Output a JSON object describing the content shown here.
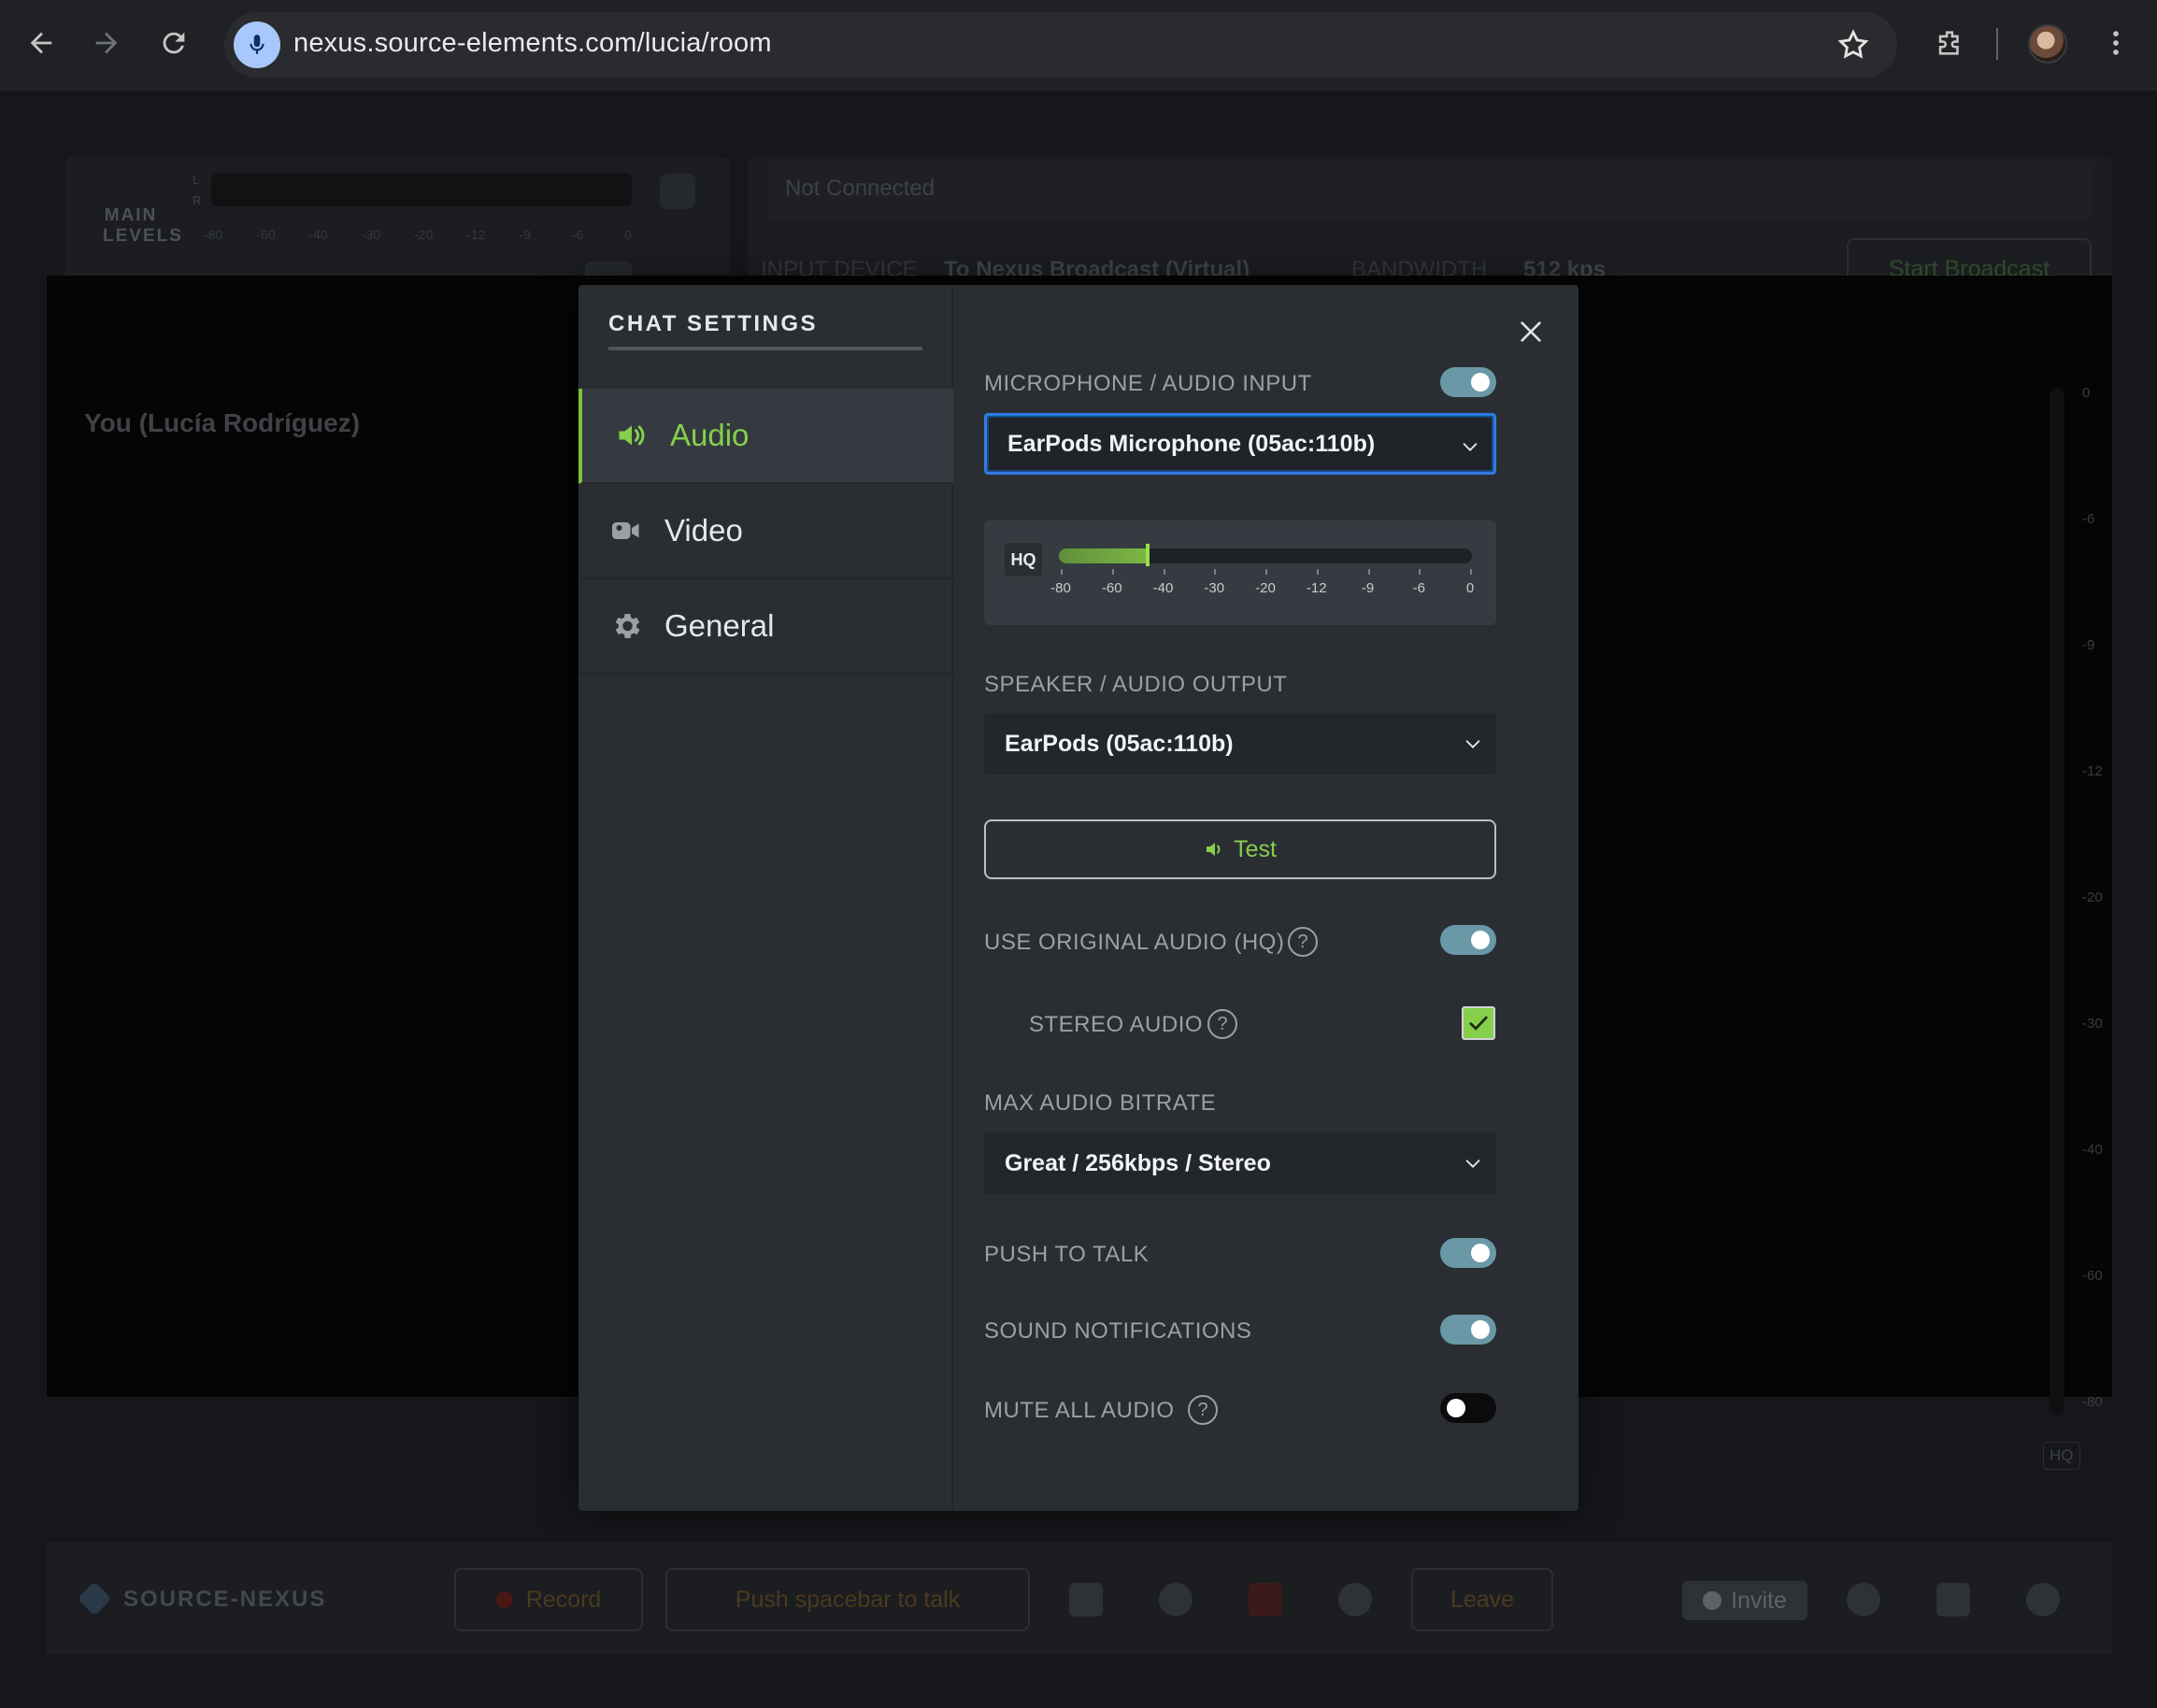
{
  "browser": {
    "url": "nexus.source-elements.com/lucia/room"
  },
  "app_bg": {
    "main_levels": "MAIN\nLEVELS",
    "main_levels_line1": "MAIN",
    "main_levels_line2": "LEVELS",
    "lr_l": "L",
    "lr_r": "R",
    "scale": [
      "-80",
      "-60",
      "-40",
      "-30",
      "-20",
      "-12",
      "-9",
      "-6",
      "0"
    ],
    "status": "Not Connected",
    "input_device_label": "INPUT DEVICE",
    "input_device_value": "To Nexus Broadcast (Virtual)",
    "bandwidth_label": "BANDWIDTH",
    "bandwidth_value": "512 kps",
    "start_broadcast": "Start Broadcast",
    "participant": "You (Lucía Rodríguez)",
    "vu_scale": [
      "0",
      "-6",
      "-9",
      "-12",
      "-20",
      "-30",
      "-40",
      "-60",
      "-80"
    ],
    "vu_hq": "HQ",
    "brand": "SOURCE-NEXUS",
    "record": "Record",
    "push_to_talk_hint": "Push spacebar to talk",
    "leave": "Leave",
    "invite": "Invite"
  },
  "modal": {
    "title": "CHAT SETTINGS",
    "nav": [
      {
        "label": "Audio",
        "icon": "speaker-icon",
        "active": true
      },
      {
        "label": "Video",
        "icon": "video-camera-icon",
        "active": false
      },
      {
        "label": "General",
        "icon": "gear-icon",
        "active": false
      }
    ],
    "mic_label": "MICROPHONE / AUDIO INPUT",
    "mic_enabled": true,
    "mic_device": "EarPods Microphone (05ac:110b)",
    "meter": {
      "badge": "HQ",
      "level_fraction": 0.21,
      "peak_fraction": 0.21,
      "scale": [
        "-80",
        "-60",
        "-40",
        "-30",
        "-20",
        "-12",
        "-9",
        "-6",
        "0"
      ]
    },
    "speaker_label": "SPEAKER / AUDIO OUTPUT",
    "speaker_device": "EarPods (05ac:110b)",
    "test_label": "Test",
    "use_original_label": "USE ORIGINAL AUDIO (HQ)",
    "use_original_enabled": true,
    "stereo_label": "STEREO AUDIO",
    "stereo_checked": true,
    "bitrate_label": "MAX AUDIO BITRATE",
    "bitrate_value": "Great / 256kbps / Stereo",
    "push_to_talk_label": "PUSH TO TALK",
    "push_to_talk_enabled": true,
    "sound_notifications_label": "SOUND NOTIFICATIONS",
    "sound_notifications_enabled": true,
    "mute_all_label": "MUTE ALL AUDIO",
    "mute_all_enabled": false,
    "help_glyph": "?"
  },
  "colors": {
    "accent_green": "#86cf4a",
    "toggle_on": "#6b98a7",
    "focus_blue": "#2f7ce0",
    "modal_bg": "#2a2e33"
  }
}
